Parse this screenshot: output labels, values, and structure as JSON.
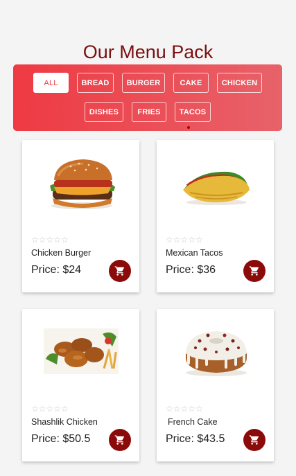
{
  "page": {
    "title": "Our Menu Pack"
  },
  "filters": [
    {
      "label": "ALL",
      "active": true
    },
    {
      "label": "BREAD"
    },
    {
      "label": "BURGER"
    },
    {
      "label": "CAKE"
    },
    {
      "label": "CHICKEN"
    },
    {
      "label": "DISHES"
    },
    {
      "label": "FRIES"
    },
    {
      "label": "TACOS"
    }
  ],
  "products": [
    {
      "name": "Chicken Burger",
      "price": "Price: $24",
      "stars": "☆☆☆☆☆",
      "image": "burger"
    },
    {
      "name": "Mexican Tacos",
      "price": "Price: $36",
      "stars": "☆☆☆☆☆",
      "image": "taco"
    },
    {
      "name": "Shashlik Chicken",
      "price": "Price: $50.5",
      "stars": "☆☆☆☆☆",
      "image": "chicken"
    },
    {
      "name": "French Cake",
      "price": "Price: $43.5",
      "stars": "☆☆☆☆☆",
      "image": "cake"
    }
  ],
  "colors": {
    "accent": "#8b0a0a",
    "title": "#7a0f0f",
    "panel_start": "#ee3a43",
    "panel_end": "#e8626a"
  }
}
